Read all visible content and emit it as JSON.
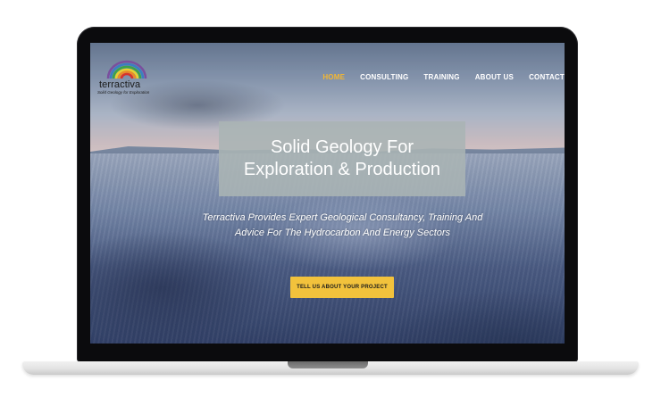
{
  "site": {
    "logo_name": "terractiva",
    "logo_tagline": "Solid Geology for Exploration"
  },
  "nav": {
    "items": [
      {
        "label": "HOME",
        "active": true
      },
      {
        "label": "CONSULTING",
        "active": false
      },
      {
        "label": "TRAINING",
        "active": false
      },
      {
        "label": "ABOUT US",
        "active": false
      },
      {
        "label": "CONTACT",
        "active": false
      }
    ]
  },
  "hero": {
    "title": "Solid Geology For Exploration & Production",
    "subtitle": "Terractiva Provides Expert Geological Consultancy, Training And Advice For The Hydrocarbon And Energy Sectors",
    "cta_label": "TELL US ABOUT YOUR PROJECT"
  },
  "colors": {
    "accent": "#f2b632",
    "cta_bg": "#f2c23c",
    "hero_box": "#aab4b4",
    "bezel": "#0b0b0d"
  },
  "icons": {
    "logo_mark": "rainbow-arc-icon"
  }
}
